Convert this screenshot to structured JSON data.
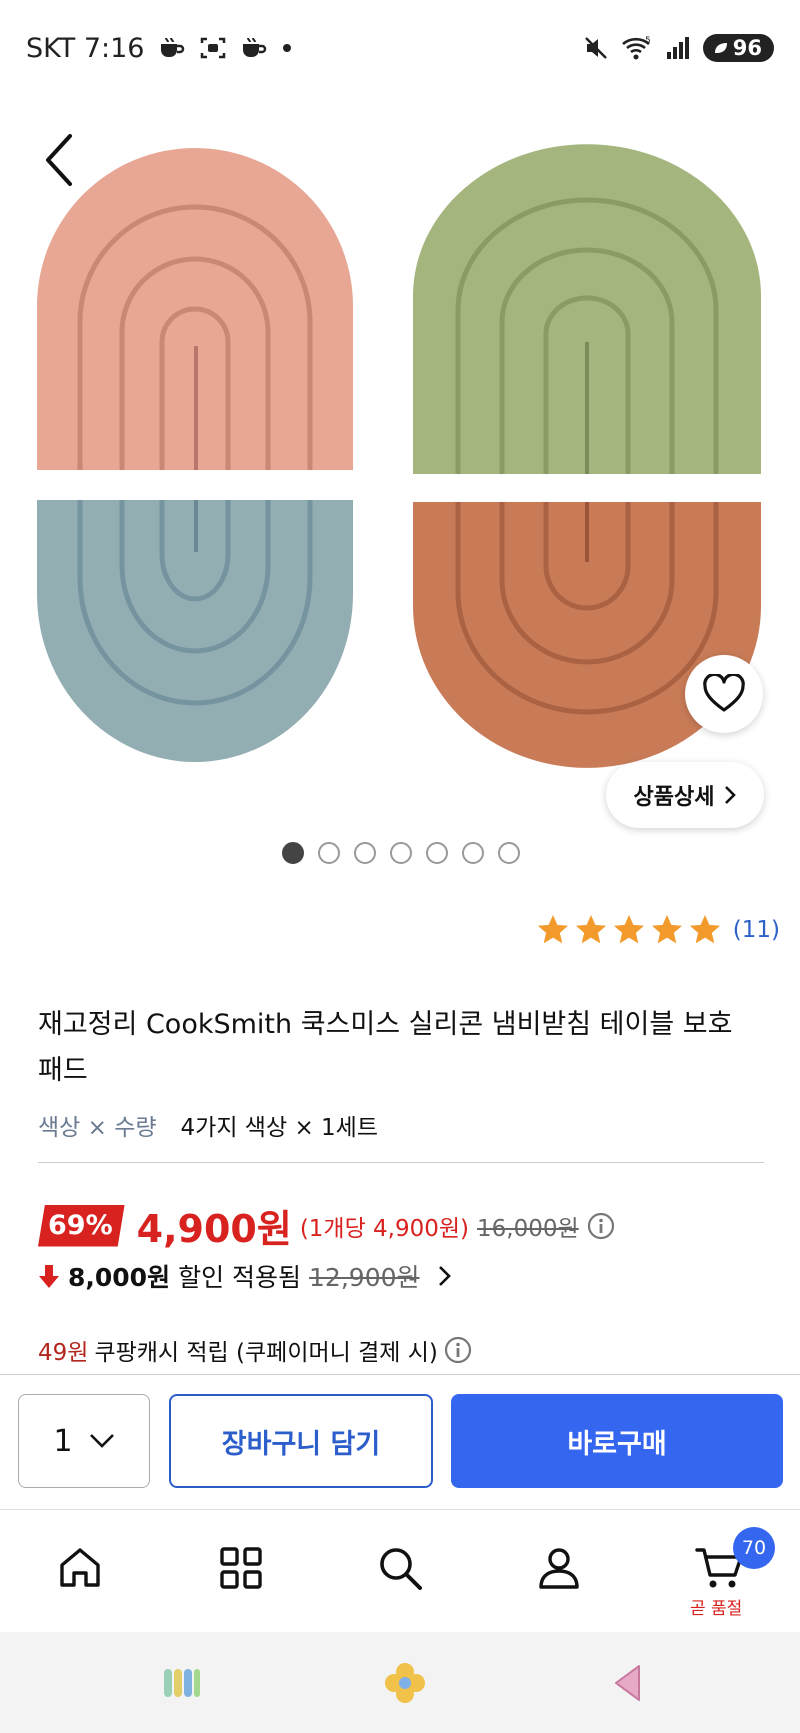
{
  "status_bar": {
    "carrier_time": "SKT 7:16",
    "battery": "96"
  },
  "gallery": {
    "detail_label": "상품상세",
    "dot_count": 7,
    "active_dot": 0,
    "pad_colors": {
      "pink": "#e8a794",
      "green": "#a4b57e",
      "blue": "#93aeb3",
      "orange": "#c97b57"
    }
  },
  "rating": {
    "stars": 5,
    "count": "(11)",
    "star_color": "#f39a2d"
  },
  "product": {
    "title": "재고정리 CookSmith 쿡스미스 실리콘 냄비받침 테이블 보호패드",
    "option_label": "색상 × 수량",
    "option_value": "4가지 색상 × 1세트"
  },
  "price": {
    "discount_rate": "69%",
    "sale_price": "4,900원",
    "unit_price": "(1개당 4,900원)",
    "original_price": "16,000원",
    "discount_amount": "8,000원",
    "discount_applied": "할인 적용됨",
    "before_discount": "12,900원",
    "cash_amount": "49원",
    "cash_text": "쿠팡캐시 적립 (쿠페이머니 결제 시)"
  },
  "actions": {
    "quantity": "1",
    "cart_label": "장바구니 담기",
    "buy_label": "바로구매"
  },
  "bottom_nav": {
    "cart_badge": "70",
    "soldout_text": "곧 품절"
  },
  "colors": {
    "accent_blue": "#3466f0",
    "sale_red": "#d8221f"
  }
}
